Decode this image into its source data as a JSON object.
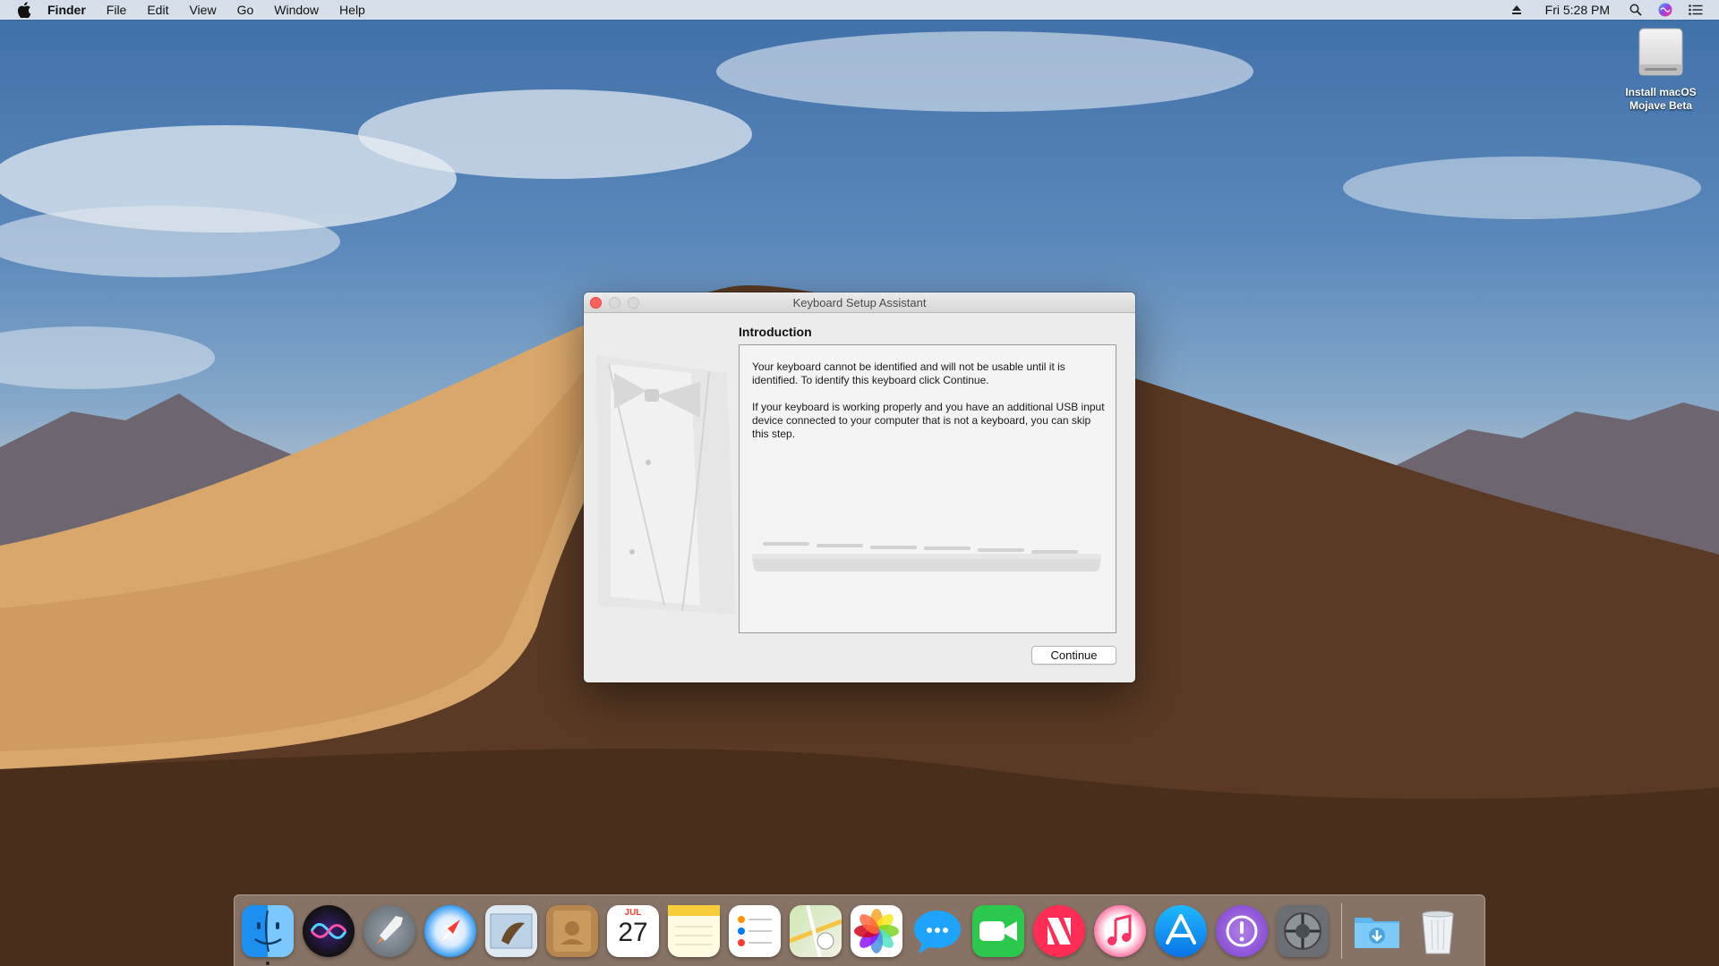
{
  "menubar": {
    "app_name": "Finder",
    "items": [
      "File",
      "Edit",
      "View",
      "Go",
      "Window",
      "Help"
    ],
    "clock": "Fri 5:28 PM",
    "status_icons": [
      "eject-icon",
      "search-icon",
      "siri-icon",
      "notification-center-icon"
    ]
  },
  "desktop": {
    "drive_label": "Install macOS\nMojave Beta"
  },
  "window": {
    "title": "Keyboard Setup Assistant",
    "heading": "Introduction",
    "paragraph1": "Your keyboard cannot be identified and will not be usable until it is identified. To identify this keyboard click Continue.",
    "paragraph2": "If your keyboard is working properly and you have an additional USB input device connected to your computer that is not a keyboard, you can skip this step.",
    "continue_label": "Continue"
  },
  "dock": {
    "calendar_month": "JUL",
    "calendar_day": "27",
    "apps": [
      "finder-icon",
      "siri-icon",
      "launchpad-icon",
      "safari-icon",
      "mail-icon",
      "contacts-icon",
      "calendar-icon",
      "notes-icon",
      "reminders-icon",
      "maps-icon",
      "photos-icon",
      "messages-icon",
      "facetime-icon",
      "news-icon",
      "itunes-icon",
      "app-store-icon",
      "feedback-assistant-icon",
      "system-preferences-icon",
      "downloads-folder-icon",
      "trash-icon"
    ]
  }
}
